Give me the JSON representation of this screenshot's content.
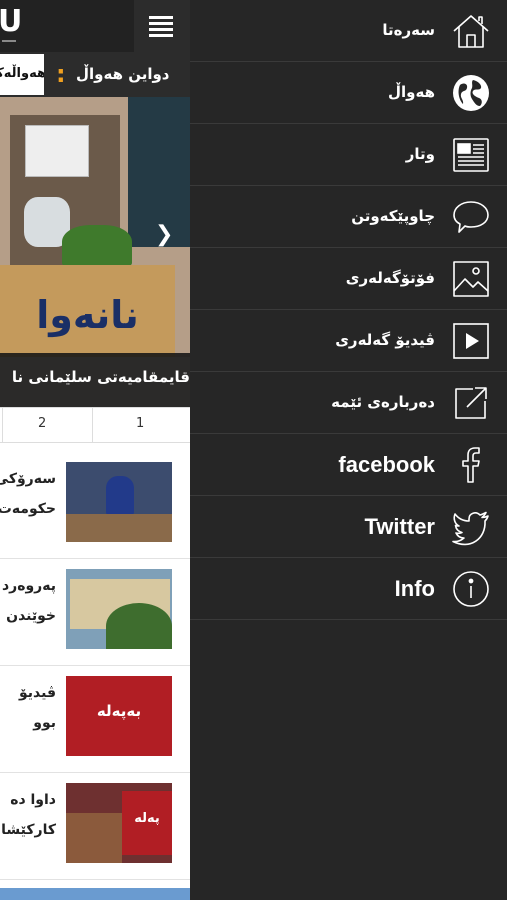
{
  "app": {
    "logo_text": "U"
  },
  "ticker": {
    "label": "دواین هەواڵ",
    "separator": ":",
    "headline": "هەواڵەکان"
  },
  "hero": {
    "sign_text": "نانەوا",
    "caption": "قایمقامیەتی سلێمانی نا"
  },
  "pager": {
    "pages": [
      "2",
      "1"
    ]
  },
  "news": [
    {
      "lines": [
        "سەرۆکی",
        "حکومەت"
      ]
    },
    {
      "lines": [
        "پەروەرد",
        "خوێندن"
      ]
    },
    {
      "lines": [
        "ڤیدیۆ",
        "بوو"
      ],
      "thumb_text": "بەپەلە"
    },
    {
      "lines": [
        "داوا دە",
        "کارکێشا"
      ],
      "thumb_text": "پەلە"
    }
  ],
  "drawer": {
    "items": [
      {
        "label": "سەرەتا",
        "icon": "home-icon"
      },
      {
        "label": "هەواڵ",
        "icon": "globe-icon"
      },
      {
        "label": "وتار",
        "icon": "newspaper-icon"
      },
      {
        "label": "چاوپێکەوتن",
        "icon": "speech-bubble-icon"
      },
      {
        "label": "فۆتۆگەلەری",
        "icon": "image-icon"
      },
      {
        "label": "ڤیدیۆ گەلەری",
        "icon": "play-icon"
      },
      {
        "label": "دەربارەی ئێمە",
        "icon": "external-link-icon"
      },
      {
        "label": "facebook",
        "icon": "facebook-icon"
      },
      {
        "label": "Twitter",
        "icon": "twitter-icon"
      },
      {
        "label": "Info",
        "icon": "info-icon"
      }
    ]
  },
  "colors": {
    "drawer_bg": "#262626",
    "topbar_bg": "#222222",
    "accent": "#f0a020",
    "text": "#ffffff"
  }
}
